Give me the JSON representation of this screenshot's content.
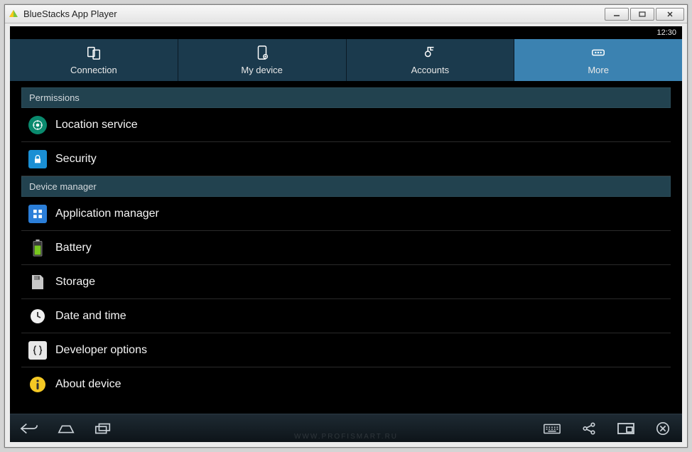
{
  "window": {
    "title": "BlueStacks App Player"
  },
  "status": {
    "time": "12:30"
  },
  "tabs": [
    {
      "id": "connection",
      "label": "Connection",
      "active": false
    },
    {
      "id": "my-device",
      "label": "My device",
      "active": false
    },
    {
      "id": "accounts",
      "label": "Accounts",
      "active": false
    },
    {
      "id": "more",
      "label": "More",
      "active": true
    }
  ],
  "sections": [
    {
      "title": "Permissions",
      "items": [
        {
          "id": "location",
          "label": "Location service"
        },
        {
          "id": "security",
          "label": "Security"
        }
      ]
    },
    {
      "title": "Device manager",
      "items": [
        {
          "id": "apps",
          "label": "Application manager"
        },
        {
          "id": "battery",
          "label": "Battery"
        },
        {
          "id": "storage",
          "label": "Storage"
        },
        {
          "id": "datetime",
          "label": "Date and time"
        },
        {
          "id": "devopts",
          "label": "Developer options"
        },
        {
          "id": "about",
          "label": "About device"
        }
      ]
    }
  ],
  "watermark": "WWW.PROFISMART.RU"
}
